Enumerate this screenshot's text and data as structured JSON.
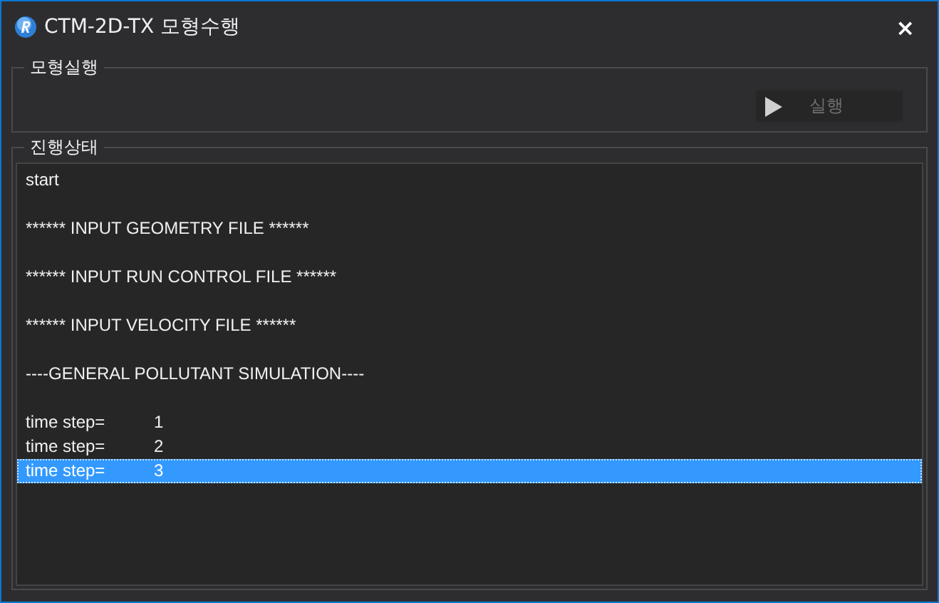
{
  "window": {
    "title": "CTM-2D-TX 모형수행",
    "close": "×"
  },
  "run_group": {
    "legend": "모형실행",
    "run_button": {
      "label": "실행",
      "disabled": true
    }
  },
  "status_group": {
    "legend": "진행상태",
    "lines": [
      {
        "kind": "text",
        "text": "start",
        "selected": false
      },
      {
        "kind": "blank"
      },
      {
        "kind": "text",
        "text": "****** INPUT GEOMETRY FILE ******",
        "selected": false
      },
      {
        "kind": "blank"
      },
      {
        "kind": "text",
        "text": "****** INPUT RUN CONTROL FILE ******",
        "selected": false
      },
      {
        "kind": "blank"
      },
      {
        "kind": "text",
        "text": "****** INPUT VELOCITY FILE ******",
        "selected": false
      },
      {
        "kind": "blank"
      },
      {
        "kind": "text",
        "text": "----GENERAL POLLUTANT SIMULATION----",
        "selected": false
      },
      {
        "kind": "blank"
      },
      {
        "kind": "step",
        "label": "time step=",
        "value": "1",
        "selected": false
      },
      {
        "kind": "step",
        "label": "time step=",
        "value": "2",
        "selected": false
      },
      {
        "kind": "step",
        "label": "time step=",
        "value": "3",
        "selected": true
      }
    ]
  }
}
